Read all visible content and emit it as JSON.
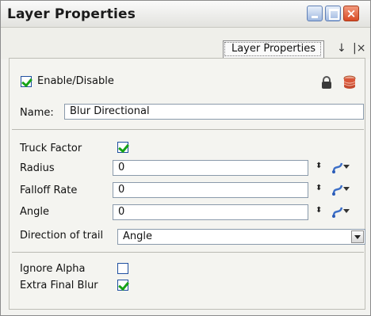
{
  "window": {
    "title": "Layer Properties",
    "close_glyph": "×"
  },
  "tab": {
    "label": "Layer Properties",
    "pin_glyph": "↓",
    "close_glyph": "|×"
  },
  "enable": {
    "label": "Enable/Disable",
    "checked": true
  },
  "name": {
    "label": "Name:",
    "value": "Blur Directional"
  },
  "params": {
    "truck_factor": {
      "label": "Truck Factor",
      "checked": true
    },
    "radius": {
      "label": "Radius",
      "value": "0"
    },
    "falloff_rate": {
      "label": "Falloff Rate",
      "value": "0"
    },
    "angle": {
      "label": "Angle",
      "value": "0"
    },
    "direction": {
      "label": "Direction of trail",
      "value": "Angle"
    }
  },
  "options": {
    "ignore_alpha": {
      "label": "Ignore Alpha",
      "checked": false
    },
    "extra_final_blur": {
      "label": "Extra Final Blur",
      "checked": true
    }
  },
  "spin_glyph": "⬍",
  "icons": [
    "lock-icon",
    "database-icon",
    "function-curve-icon"
  ],
  "colors": {
    "check": "#17a317",
    "border": "#1f4fa0",
    "close_button": "#d84a24"
  }
}
